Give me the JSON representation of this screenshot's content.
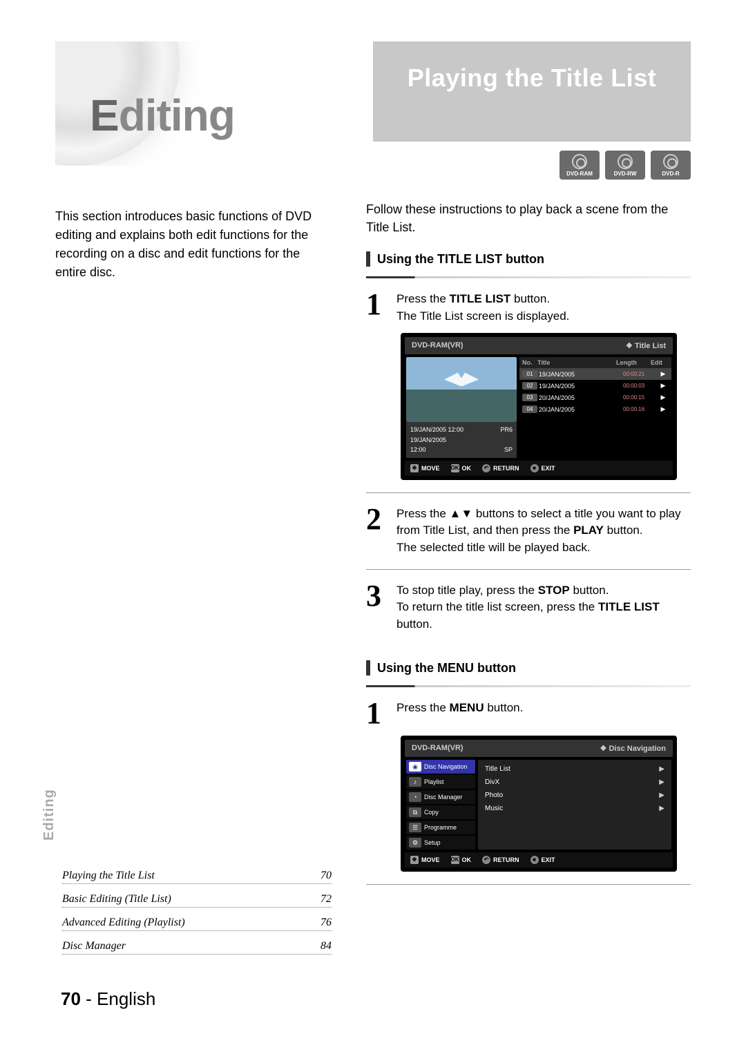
{
  "page": {
    "number": "70",
    "language": "English",
    "section_tab": "Editing"
  },
  "left": {
    "chapter_title_first": "E",
    "chapter_title_rest": "diting",
    "intro": "This section introduces basic functions of DVD editing and explains both edit functions for the recording on a disc and edit functions for the entire disc."
  },
  "toc": {
    "items": [
      {
        "label": "Playing the Title List",
        "page": "70"
      },
      {
        "label": "Basic Editing (Title List)",
        "page": "72"
      },
      {
        "label": "Advanced Editing (Playlist)",
        "page": "76"
      },
      {
        "label": "Disc Manager",
        "page": "84"
      }
    ]
  },
  "right": {
    "heading": "Playing the Title List",
    "disc_labels": [
      "DVD-RAM",
      "DVD-RW",
      "DVD-R"
    ],
    "intro": "Follow these instructions to play back a scene from the Title List.",
    "section_a": {
      "title": "Using the TITLE LIST button",
      "steps": {
        "s1": {
          "num": "1",
          "t1": "Press the ",
          "b1": "TITLE LIST",
          "t2": " button.",
          "t3": "The Title List screen is displayed."
        },
        "s2": {
          "num": "2",
          "t1": "Press the ▲▼ buttons to select a title you want to play from Title List, and then press the ",
          "b1": "PLAY",
          "t2": " button.",
          "t3": "The selected title will be played back."
        },
        "s3": {
          "num": "3",
          "t1": "To stop title play, press the ",
          "b1": "STOP",
          "t2": " button.",
          "t3": "To return the title list screen, press the ",
          "b2": "TITLE LIST",
          "t4": " button."
        }
      }
    },
    "section_b": {
      "title": "Using the MENU button",
      "steps": {
        "s1": {
          "num": "1",
          "t1": "Press the ",
          "b1": "MENU",
          "t2": " button."
        }
      }
    }
  },
  "osd_title_list": {
    "hdr_left": "DVD-RAM(VR)",
    "hdr_right": "Title List",
    "cols": {
      "no": "No.",
      "title": "Title",
      "length": "Length",
      "edit": "Edit"
    },
    "rows": [
      {
        "no": "01",
        "title": "19/JAN/2005",
        "length": "00:00:21",
        "edit": "▶"
      },
      {
        "no": "02",
        "title": "19/JAN/2005",
        "length": "00:00:03",
        "edit": "▶"
      },
      {
        "no": "03",
        "title": "20/JAN/2005",
        "length": "00:00:15",
        "edit": "▶"
      },
      {
        "no": "04",
        "title": "20/JAN/2005",
        "length": "00:00:16",
        "edit": "▶"
      }
    ],
    "preview_meta": {
      "r1l": "19/JAN/2005 12:00",
      "r1r": "PR6",
      "r2l": "19/JAN/2005",
      "r2r": "",
      "r3l": "12:00",
      "r3r": "SP"
    },
    "footer": {
      "move": "MOVE",
      "ok": "OK",
      "return": "RETURN",
      "exit": "EXIT"
    }
  },
  "osd_menu": {
    "hdr_left": "DVD-RAM(VR)",
    "hdr_right": "Disc Navigation",
    "side": [
      {
        "label": "Disc Navigation",
        "sel": true
      },
      {
        "label": "Playlist",
        "sel": false
      },
      {
        "label": "Disc Manager",
        "sel": false
      },
      {
        "label": "Copy",
        "sel": false
      },
      {
        "label": "Programme",
        "sel": false
      },
      {
        "label": "Setup",
        "sel": false
      }
    ],
    "main": [
      {
        "label": "Title List"
      },
      {
        "label": "DivX"
      },
      {
        "label": "Photo"
      },
      {
        "label": "Music"
      }
    ],
    "footer": {
      "move": "MOVE",
      "ok": "OK",
      "return": "RETURN",
      "exit": "EXIT"
    }
  }
}
